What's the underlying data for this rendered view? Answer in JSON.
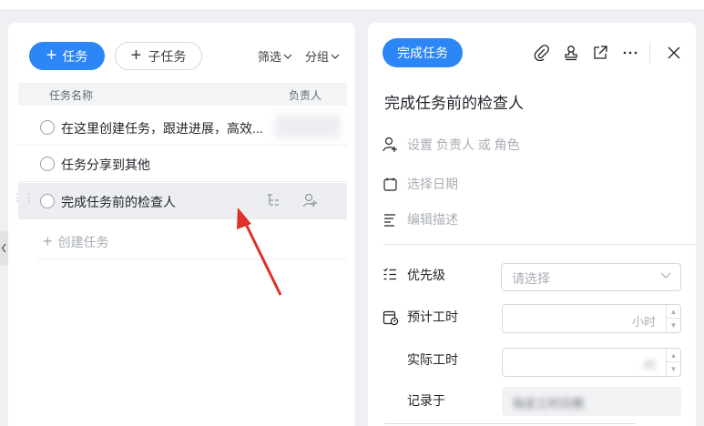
{
  "toolbar": {
    "add_task_label": "任务",
    "add_subtask_label": "子任务",
    "filter_label": "筛选",
    "group_label": "分组"
  },
  "table": {
    "col_name": "任务名称",
    "col_assignee": "负责人",
    "rows": [
      {
        "name": "在这里创建任务，跟进进展，高效..."
      },
      {
        "name": "任务分享到其他"
      },
      {
        "name": "完成任务前的检查人"
      }
    ],
    "create_label": "创建任务"
  },
  "detail": {
    "status_label": "完成任务",
    "title": "完成任务前的检查人",
    "assign": {
      "set": "设置",
      "assignee": "负责人",
      "or": "或",
      "role": "角色"
    },
    "date_placeholder": "选择日期",
    "desc_placeholder": "编辑描述",
    "fields": {
      "priority_label": "优先级",
      "priority_placeholder": "请选择",
      "estimate_label": "预计工时",
      "estimate_unit": "小时",
      "actual_label": "实际工时",
      "actual_unit": "时",
      "recorded_label": "记录于",
      "recorded_value": "指定工时日期"
    }
  },
  "colors": {
    "accent": "#2c86f5",
    "arrow": "#e0302b",
    "selected_row": "#eceef1"
  }
}
